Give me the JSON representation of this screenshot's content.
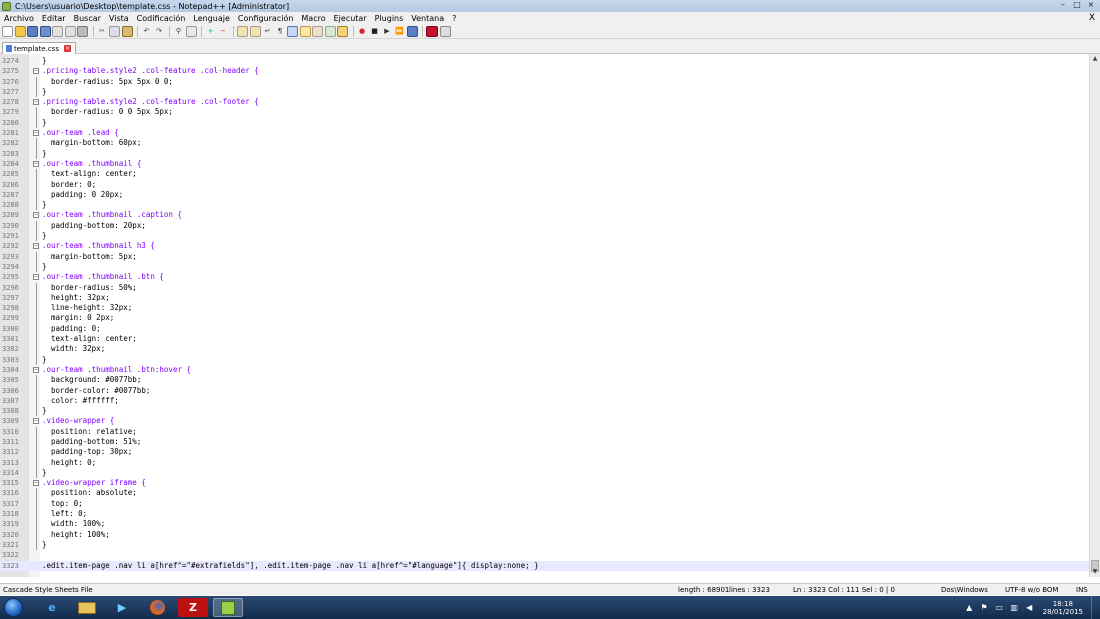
{
  "window": {
    "title": "C:\\Users\\usuario\\Desktop\\template.css - Notepad++ [Administrator]",
    "controls": [
      "–",
      "□",
      "×"
    ]
  },
  "menu": {
    "items": [
      "Archivo",
      "Editar",
      "Buscar",
      "Vista",
      "Codificación",
      "Lenguaje",
      "Configuración",
      "Macro",
      "Ejecutar",
      "Plugins",
      "Ventana",
      "?"
    ],
    "close": "X"
  },
  "tab": {
    "label": "template.css"
  },
  "editor": {
    "lines": [
      {
        "n": "3274",
        "text": "}"
      },
      {
        "n": "3275",
        "text": ".pricing-table.style2 .col-feature .col-header {",
        "fold": true
      },
      {
        "n": "3276",
        "text": "  border-radius: 5px 5px 0 0;"
      },
      {
        "n": "3277",
        "text": "}"
      },
      {
        "n": "3278",
        "text": ".pricing-table.style2 .col-feature .col-footer {",
        "fold": true
      },
      {
        "n": "3279",
        "text": "  border-radius: 0 0 5px 5px;"
      },
      {
        "n": "3280",
        "text": "}"
      },
      {
        "n": "3281",
        "text": ".our-team .lead {",
        "fold": true
      },
      {
        "n": "3282",
        "text": "  margin-bottom: 60px;"
      },
      {
        "n": "3283",
        "text": "}"
      },
      {
        "n": "3284",
        "text": ".our-team .thumbnail {",
        "fold": true
      },
      {
        "n": "3285",
        "text": "  text-align: center;"
      },
      {
        "n": "3286",
        "text": "  border: 0;"
      },
      {
        "n": "3287",
        "text": "  padding: 0 20px;"
      },
      {
        "n": "3288",
        "text": "}"
      },
      {
        "n": "3289",
        "text": ".our-team .thumbnail .caption {",
        "fold": true
      },
      {
        "n": "3290",
        "text": "  padding-bottom: 20px;"
      },
      {
        "n": "3291",
        "text": "}"
      },
      {
        "n": "3292",
        "text": ".our-team .thumbnail h3 {",
        "fold": true
      },
      {
        "n": "3293",
        "text": "  margin-bottom: 5px;"
      },
      {
        "n": "3294",
        "text": "}"
      },
      {
        "n": "3295",
        "text": ".our-team .thumbnail .btn {",
        "fold": true
      },
      {
        "n": "3296",
        "text": "  border-radius: 50%;"
      },
      {
        "n": "3297",
        "text": "  height: 32px;"
      },
      {
        "n": "3298",
        "text": "  line-height: 32px;"
      },
      {
        "n": "3299",
        "text": "  margin: 0 2px;"
      },
      {
        "n": "3300",
        "text": "  padding: 0;"
      },
      {
        "n": "3301",
        "text": "  text-align: center;"
      },
      {
        "n": "3302",
        "text": "  width: 32px;"
      },
      {
        "n": "3303",
        "text": "}"
      },
      {
        "n": "3304",
        "text": ".our-team .thumbnail .btn:hover {",
        "fold": true
      },
      {
        "n": "3305",
        "text": "  background: #0077bb;"
      },
      {
        "n": "3306",
        "text": "  border-color: #0077bb;"
      },
      {
        "n": "3307",
        "text": "  color: #ffffff;"
      },
      {
        "n": "3308",
        "text": "}"
      },
      {
        "n": "3309",
        "text": ".video-wrapper {",
        "fold": true
      },
      {
        "n": "3310",
        "text": "  position: relative;"
      },
      {
        "n": "3311",
        "text": "  padding-bottom: 51%;"
      },
      {
        "n": "3312",
        "text": "  padding-top: 30px;"
      },
      {
        "n": "3313",
        "text": "  height: 0;"
      },
      {
        "n": "3314",
        "text": "}"
      },
      {
        "n": "3315",
        "text": ".video-wrapper iframe {",
        "fold": true
      },
      {
        "n": "3316",
        "text": "  position: absolute;"
      },
      {
        "n": "3317",
        "text": "  top: 0;"
      },
      {
        "n": "3318",
        "text": "  left: 0;"
      },
      {
        "n": "3319",
        "text": "  width: 100%;"
      },
      {
        "n": "3320",
        "text": "  height: 100%;"
      },
      {
        "n": "3321",
        "text": "}"
      },
      {
        "n": "3322",
        "text": ""
      },
      {
        "n": "3323",
        "text": ".edit.item-page .nav li a[href^=\"#extrafields\"], .edit.item-page .nav li a[href^=\"#language\"]{ display:none; }",
        "current": true
      }
    ]
  },
  "status": {
    "language": "Cascade Style Sheets File",
    "length": "length : 68901",
    "lines": "lines : 3323",
    "position": "Ln : 3323    Col : 111    Sel : 0 | 0",
    "eol": "Dos\\Windows",
    "encoding": "UTF-8 w/o BOM",
    "mode": "INS"
  },
  "taskbar": {
    "time": "18:18",
    "date": "28/01/2015"
  },
  "colors": {
    "selector": "#8000ff",
    "property": "#8000ff",
    "current_line": "#e8e8ff"
  }
}
